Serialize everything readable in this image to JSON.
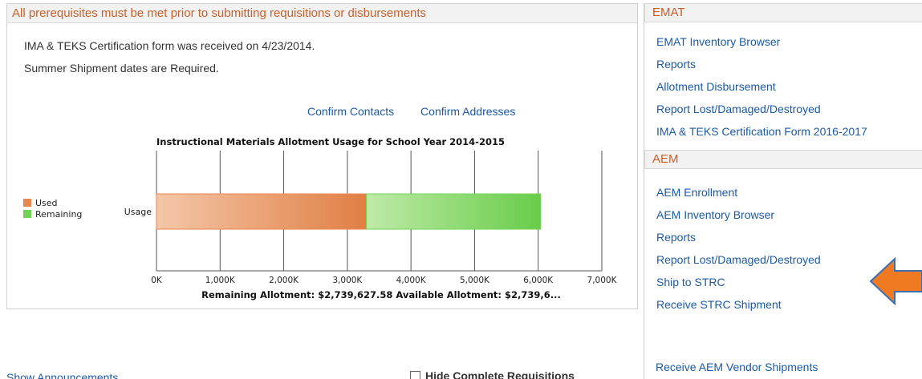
{
  "prereq": {
    "header": "All prerequisites must be met prior to submitting requisitions or disbursements",
    "line1": "IMA & TEKS Certification form was received on 4/23/2014.",
    "line2": "Summer Shipment dates are Required."
  },
  "confirm": {
    "contacts": "Confirm Contacts",
    "addresses": "Confirm Addresses"
  },
  "chart_data": {
    "type": "bar",
    "orientation": "horizontal",
    "stacked": true,
    "title": "Instructional Materials Allotment Usage for School Year 2014-2015",
    "categories": [
      "Usage"
    ],
    "series": [
      {
        "name": "Used",
        "values": [
          3300000
        ],
        "color": "#e8874e"
      },
      {
        "name": "Remaining",
        "values": [
          2739627.58
        ],
        "color": "#72d356"
      }
    ],
    "xlim": [
      0,
      7000000
    ],
    "x_ticks": [
      "0K",
      "1,000K",
      "2,000K",
      "3,000K",
      "4,000K",
      "5,000K",
      "6,000K",
      "7,000K"
    ],
    "grid": true,
    "legend": "left",
    "footer": "Remaining Allotment: $2,739,627.58   Available Allotment: $2,739,6..."
  },
  "emat": {
    "header": "EMAT",
    "links": [
      "EMAT Inventory Browser",
      "Reports",
      "Allotment Disbursement",
      "Report Lost/Damaged/Destroyed",
      "IMA & TEKS Certification Form 2016-2017"
    ]
  },
  "aem": {
    "header": "AEM",
    "links": [
      "AEM Enrollment",
      "AEM Inventory Browser",
      "Reports",
      "Report Lost/Damaged/Destroyed",
      "Ship to STRC",
      "Receive STRC Shipment"
    ],
    "extra_link": "Receive AEM Vendor Shipments"
  },
  "arrow": {
    "icon": "left-arrow-icon",
    "color": "#f07a22"
  },
  "bottom": {
    "announcements": "Show Announcements",
    "hide_complete": "Hide Complete Requisitions"
  }
}
